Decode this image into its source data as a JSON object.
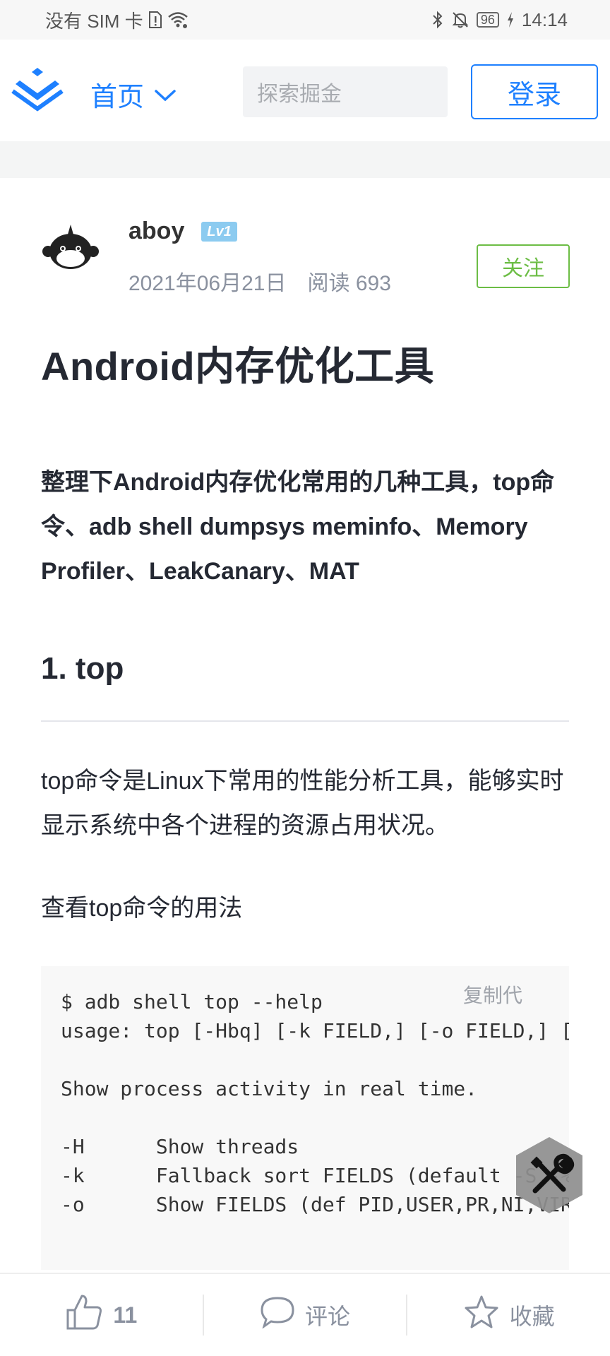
{
  "status_bar": {
    "carrier": "没有 SIM 卡",
    "battery": "96",
    "time": "14:14"
  },
  "header": {
    "nav_label": "首页",
    "search_placeholder": "探索掘金",
    "login_label": "登录"
  },
  "author": {
    "name": "aboy",
    "level": "Lv1",
    "date": "2021年06月21日",
    "reads": "阅读 693",
    "follow_label": "关注"
  },
  "article": {
    "title": "Android内存优化工具",
    "summary": "整理下Android内存优化常用的几种工具，top命令、adb shell dumpsys meminfo、Memory Profiler、LeakCanary、MAT",
    "section1_heading": "1. top",
    "paragraph1": "top命令是Linux下常用的性能分析工具，能够实时显示系统中各个进程的资源占用状况。",
    "paragraph2": "查看top命令的用法",
    "copy_code_label": "复制代",
    "code": "$ adb shell top --help\nusage: top [-Hbq] [-k FIELD,] [-o FIELD,] [-s SORT] [-n NUMBER] [-m LINES] [-d SECONDS] [-p PID,] [-u USER,]\n\nShow process activity in real time.\n\n-H      Show threads\n-k      Fallback sort FIELDS (default -S,-%CPU,-ETIME,-PID)\n-o      Show FIELDS (def PID,USER,PR,NI,VIRT,RES,SHR,S,%CPU,%MEM,TIME+,CMDLINE)"
  },
  "bottom_bar": {
    "likes": "11",
    "comment_label": "评论",
    "collect_label": "收藏"
  },
  "colors": {
    "brand_blue": "#1e80ff",
    "follow_green": "#6cbd45",
    "level_badge": "#8ccbf0"
  }
}
